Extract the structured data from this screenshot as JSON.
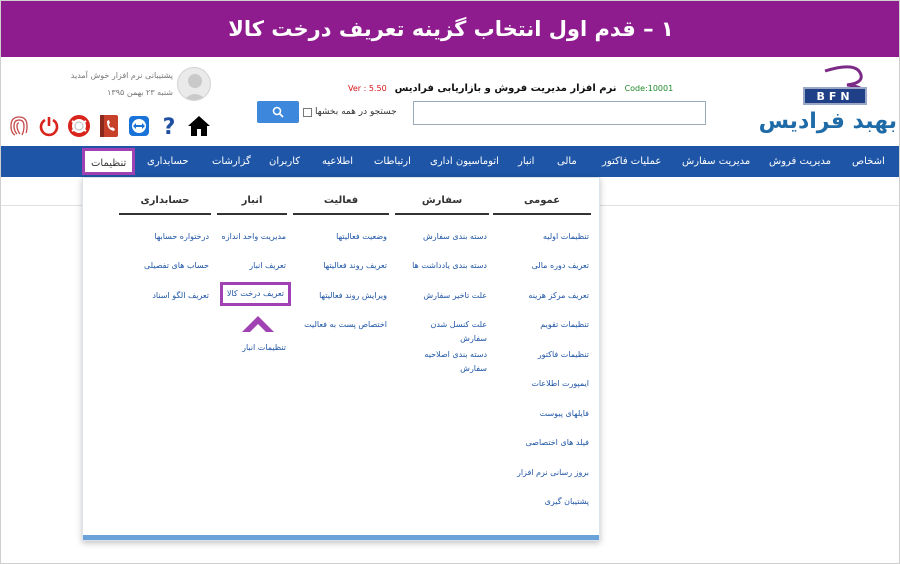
{
  "banner": {
    "text": "۱ – قدم اول انتخاب گزینه تعریف درخت کالا"
  },
  "header": {
    "app_name": "نرم افزار مدیریت فروش و بازاریابی فرادیس",
    "code": "Code:10001",
    "version": "Ver : 5.50",
    "logo_bfn": "BFN",
    "logo_name": "بهبد فرادیس",
    "search": {
      "value": "",
      "all_sections_label": "جستجو در همه بخشها"
    },
    "user": {
      "greeting": "پشتیبانی نرم افزار خوش آمدید",
      "date": "شنبه ۲۳ بهمن ۱۳۹۵"
    }
  },
  "nav": {
    "items": [
      "اشخاص",
      "مدیریت فروش",
      "مدیریت سفارش",
      "عملیات فاکتور",
      "مالی",
      "انبار",
      "اتوماسیون اداری",
      "ارتباطات",
      "اطلاعیه",
      "کاربران",
      "گزارشات",
      "حسابداری",
      "تنظیمات"
    ],
    "active": "تنظیمات"
  },
  "menu": {
    "columns": [
      {
        "title": "عمومی",
        "items": [
          "تنظیمات اولیه",
          "تعریف دوره مالی",
          "تعریف مرکز هزینه",
          "تنظیمات تقویم",
          "تنظیمات فاکتور",
          "ایمپورت اطلاعات",
          "فایلهای پیوست",
          "فیلد های اختصاصی",
          "بروز رسانی نرم افزار",
          "پشتیبان گیری"
        ]
      },
      {
        "title": "سفارش",
        "items": [
          "دسته بندی سفارش",
          "دسته بندی یادداشت ها",
          "علت تاخیر سفارش",
          "علت کنسل شدن سفارش",
          "دسته بندی اصلاحیه سفارش"
        ]
      },
      {
        "title": "فعالیت",
        "items": [
          "وضعیت فعالیتها",
          "تعریف روند فعالیتها",
          "ویرایش روند فعالیتها",
          "اختصاص پست به فعالیت"
        ]
      },
      {
        "title": "انبار",
        "items": [
          "مدیریت واحد اندازه",
          "تعریف انبار",
          "تعریف درخت کالا",
          "تنظیمات انبار"
        ],
        "highlighted": "تعریف درخت کالا"
      },
      {
        "title": "حسابداری",
        "items": [
          "درختواره حسابها",
          "حساب های تفصیلی",
          "تعریف الگو اسناد"
        ]
      }
    ]
  },
  "colors": {
    "banner": "#8e1c8f",
    "nav": "#1e55a6",
    "highlight": "#a142b4",
    "link": "#1f55a6"
  }
}
